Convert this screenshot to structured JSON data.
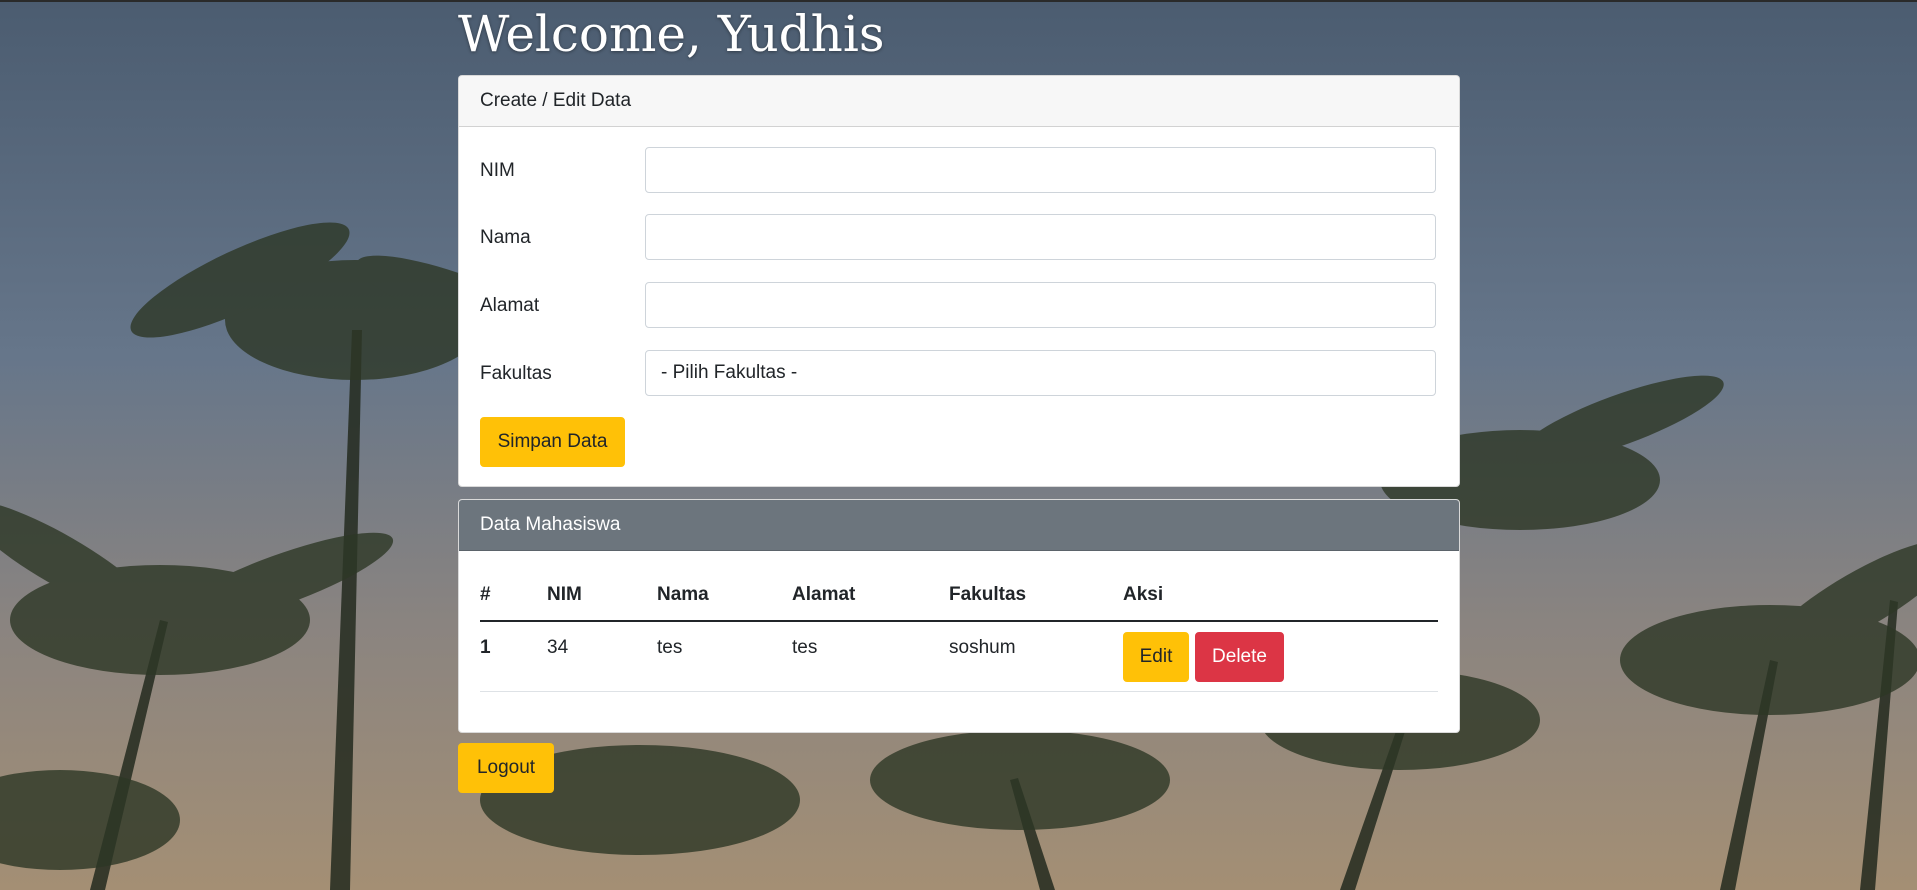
{
  "page": {
    "welcome": "Welcome, Yudhis"
  },
  "form": {
    "header": "Create / Edit Data",
    "fields": {
      "nim": {
        "label": "NIM",
        "value": ""
      },
      "nama": {
        "label": "Nama",
        "value": ""
      },
      "alamat": {
        "label": "Alamat",
        "value": ""
      },
      "fakultas": {
        "label": "Fakultas",
        "selected": "- Pilih Fakultas -"
      }
    },
    "submit_label": "Simpan Data"
  },
  "table": {
    "header": "Data Mahasiswa",
    "columns": [
      "#",
      "NIM",
      "Nama",
      "Alamat",
      "Fakultas",
      "Aksi"
    ],
    "rows": [
      {
        "no": "1",
        "nim": "34",
        "nama": "tes",
        "alamat": "tes",
        "fakultas": "soshum",
        "edit_label": "Edit",
        "delete_label": "Delete"
      }
    ]
  },
  "logout_label": "Logout",
  "colors": {
    "warning": "#ffc107",
    "danger": "#dc3545",
    "secondary_header": "#6c757d"
  }
}
